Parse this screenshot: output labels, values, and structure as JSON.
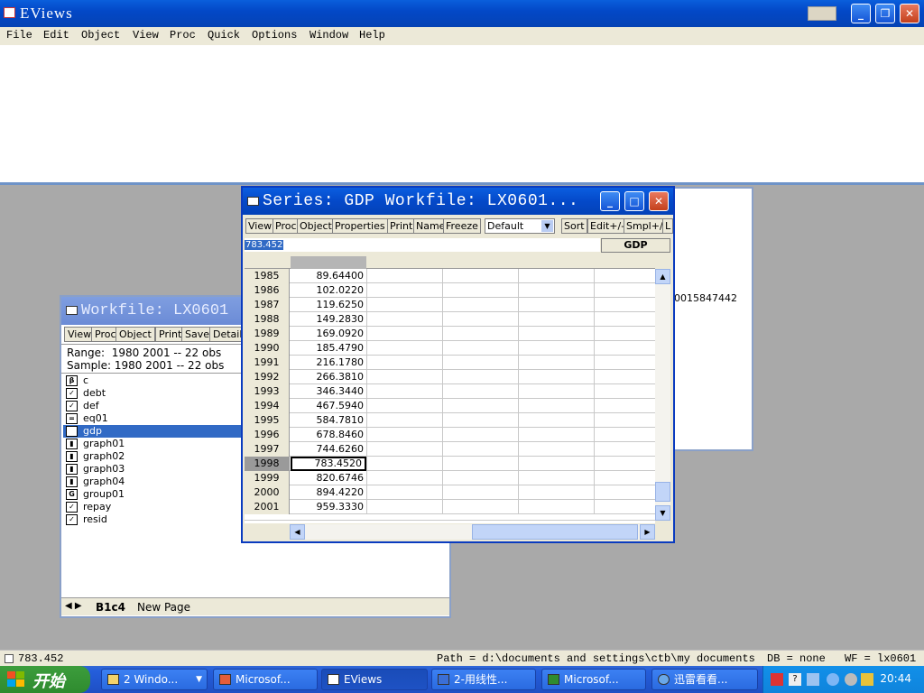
{
  "app": {
    "title": "EViews"
  },
  "menu": [
    "File",
    "Edit",
    "Object",
    "View",
    "Proc",
    "Quick",
    "Options",
    "Window",
    "Help"
  ],
  "workfile_window": {
    "title": "Workfile: LX0601",
    "toolbar": [
      "View",
      "Proc",
      "Object",
      "Print",
      "Save",
      "Details"
    ],
    "range_label": "Range:",
    "range_value": "1980 2001  --  22 obs",
    "sample_label": "Sample:",
    "sample_value": "1980 2001  --  22 obs",
    "items": [
      {
        "name": "c",
        "icon": "β"
      },
      {
        "name": "debt",
        "icon": "✓"
      },
      {
        "name": "def",
        "icon": "✓"
      },
      {
        "name": "eq01",
        "icon": "="
      },
      {
        "name": "gdp",
        "icon": "✓"
      },
      {
        "name": "graph01",
        "icon": "▮"
      },
      {
        "name": "graph02",
        "icon": "▮"
      },
      {
        "name": "graph03",
        "icon": "▮"
      },
      {
        "name": "graph04",
        "icon": "▮"
      },
      {
        "name": "group01",
        "icon": "G"
      },
      {
        "name": "repay",
        "icon": "✓"
      },
      {
        "name": "resid",
        "icon": "✓"
      }
    ],
    "tabs": [
      "B1c4",
      "New Page"
    ]
  },
  "bg_window": {
    "text": "0015847442"
  },
  "series_window": {
    "title": "Series: GDP   Workfile: LX0601...",
    "toolbar": [
      "View",
      "Proc",
      "Object",
      "Properties",
      "Print",
      "Name",
      "Freeze",
      "Sort",
      "Edit+/-",
      "Smpl+/-",
      "L"
    ],
    "format_select": "Default",
    "edit_value": "783.452",
    "column_header": "GDP",
    "rows": [
      {
        "year": "1985",
        "value": "89.64400"
      },
      {
        "year": "1986",
        "value": "102.0220"
      },
      {
        "year": "1987",
        "value": "119.6250"
      },
      {
        "year": "1988",
        "value": "149.2830"
      },
      {
        "year": "1989",
        "value": "169.0920"
      },
      {
        "year": "1990",
        "value": "185.4790"
      },
      {
        "year": "1991",
        "value": "216.1780"
      },
      {
        "year": "1992",
        "value": "266.3810"
      },
      {
        "year": "1993",
        "value": "346.3440"
      },
      {
        "year": "1994",
        "value": "467.5940"
      },
      {
        "year": "1995",
        "value": "584.7810"
      },
      {
        "year": "1996",
        "value": "678.8460"
      },
      {
        "year": "1997",
        "value": "744.6260"
      },
      {
        "year": "1998",
        "value": "783.4520"
      },
      {
        "year": "1999",
        "value": "820.6746"
      },
      {
        "year": "2000",
        "value": "894.4220"
      },
      {
        "year": "2001",
        "value": "959.3330"
      }
    ]
  },
  "status_bar": {
    "value": "783.452",
    "path": "Path = d:\\documents and settings\\ctb\\my documents",
    "db": "DB = none",
    "wf": "WF = lx0601"
  },
  "taskbar": {
    "start": "开始",
    "tasks": [
      "2 Windo...",
      "Microsof...",
      "EViews",
      "2-用线性...",
      "Microsof...",
      "迅雷看看..."
    ],
    "clock": "20:44"
  },
  "colors": {
    "selection": "#316ac5",
    "titlebar": "#0449c9"
  }
}
